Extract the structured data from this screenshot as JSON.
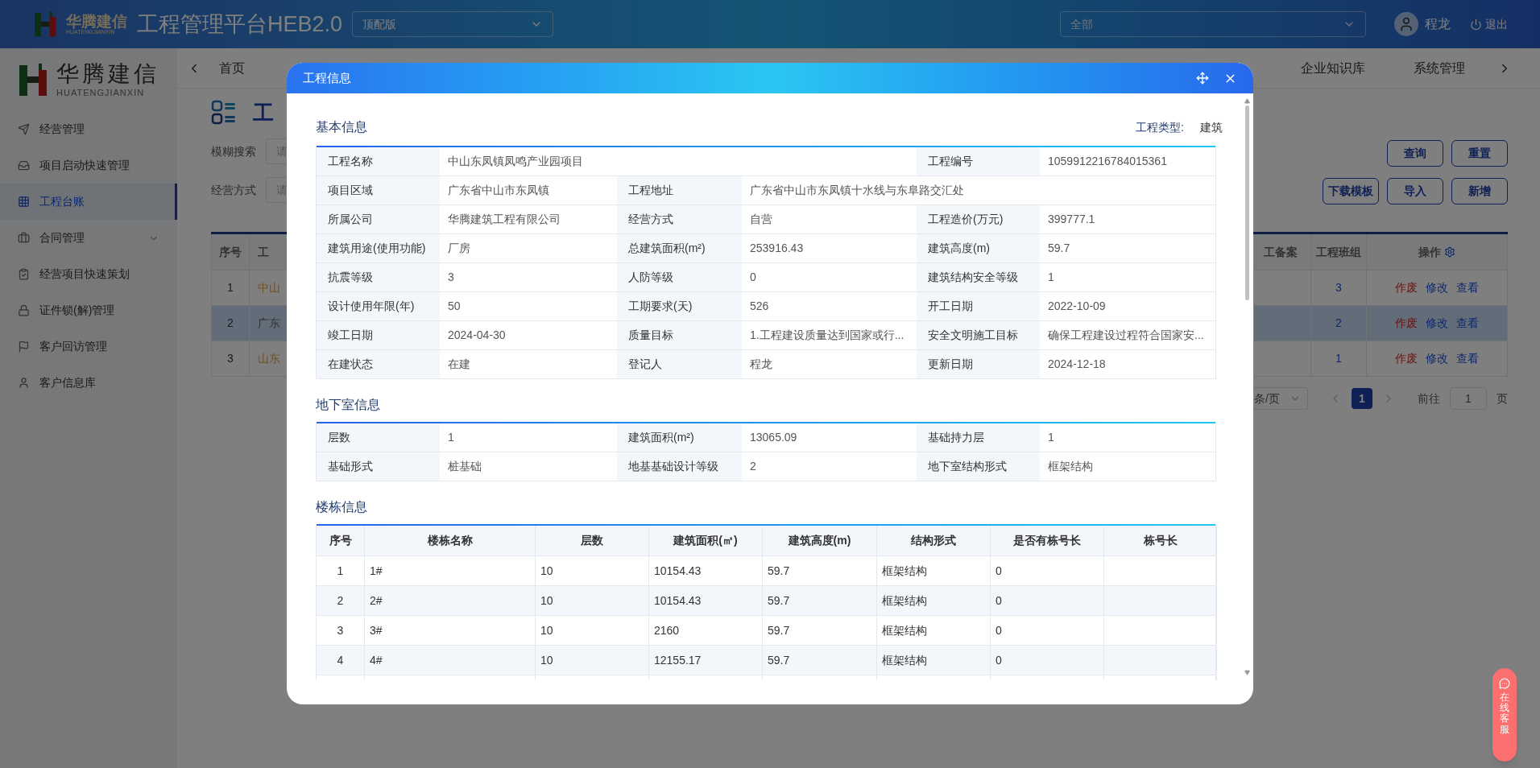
{
  "header": {
    "logo": {
      "name": "华腾建信",
      "subtitle": "HUATENGJIANXIN"
    },
    "title": "工程管理平台HEB2.0",
    "edition_select": {
      "value": "顶配版"
    },
    "scope_select": {
      "value": "全部"
    },
    "user": "程龙",
    "logout": "退出"
  },
  "sidebar": {
    "logo": {
      "name": "华腾建信",
      "subtitle": "HUATENGJIANXIN"
    },
    "items": [
      {
        "label": "经营管理",
        "selected": false,
        "has_submenu": false
      },
      {
        "label": "项目启动快速管理",
        "selected": false,
        "has_submenu": false
      },
      {
        "label": "工程台账",
        "selected": true,
        "has_submenu": false
      },
      {
        "label": "合同管理",
        "selected": false,
        "has_submenu": true
      },
      {
        "label": "经营项目快速策划",
        "selected": false,
        "has_submenu": false
      },
      {
        "label": "证件锁(解)管理",
        "selected": false,
        "has_submenu": false
      },
      {
        "label": "客户回访管理",
        "selected": false,
        "has_submenu": false
      },
      {
        "label": "客户信息库",
        "selected": false,
        "has_submenu": false
      }
    ]
  },
  "nav_tabs": {
    "left": [
      "首页"
    ],
    "right": [
      "企业知识库",
      "系统管理"
    ]
  },
  "page": {
    "title": "工",
    "filters": [
      {
        "label": "模糊搜索",
        "placeholder": "请"
      },
      {
        "label": "经营方式",
        "placeholder": "请"
      }
    ],
    "button_rows": [
      [
        "查询",
        "重置"
      ],
      [
        "下载模板",
        "导入",
        "新增"
      ]
    ],
    "table": {
      "columns_left": [
        "序号",
        "工"
      ],
      "columns_right": [
        "工备案",
        "工程班组",
        "操作"
      ],
      "rows": [
        {
          "index": "1",
          "name": "中山",
          "kind": "warning",
          "team": "3",
          "highlighted": false,
          "actions": [
            {
              "label": "作废",
              "kind": "danger"
            },
            {
              "label": "修改",
              "kind": "normal"
            },
            {
              "label": "查看",
              "kind": "normal"
            }
          ]
        },
        {
          "index": "2",
          "name": "广东",
          "kind": "normal",
          "team": "2",
          "highlighted": true,
          "actions": [
            {
              "label": "作废",
              "kind": "danger"
            },
            {
              "label": "修改",
              "kind": "normal"
            },
            {
              "label": "查看",
              "kind": "normal"
            }
          ]
        },
        {
          "index": "3",
          "name": "山东",
          "kind": "warning",
          "team": "1",
          "highlighted": false,
          "actions": [
            {
              "label": "作废",
              "kind": "danger"
            },
            {
              "label": "修改",
              "kind": "normal"
            },
            {
              "label": "查看",
              "kind": "normal"
            }
          ]
        }
      ]
    },
    "pagination": {
      "page_size": "条/页",
      "pages": [
        {
          "label": "1",
          "selected": true
        }
      ],
      "goto_label": "前往",
      "goto_value": "1",
      "page_suffix": "页"
    }
  },
  "modal": {
    "title": "工程信息",
    "basic": {
      "title": "基本信息",
      "type_label": "工程类型:",
      "type_value": "建筑",
      "rows": [
        [
          {
            "label": "工程名称",
            "value": "中山东凤镇凤鸣产业园项目",
            "wide": true
          },
          {
            "label": "工程编号",
            "value": "1059912216784015361",
            "wide": false
          }
        ],
        [
          {
            "label": "项目区域",
            "value": "广东省中山市东凤镇",
            "wide": false
          },
          {
            "label": "工程地址",
            "value": "广东省中山市东凤镇十水线与东阜路交汇处",
            "wide": true
          }
        ],
        [
          {
            "label": "所属公司",
            "value": "华腾建筑工程有限公司",
            "wide": false
          },
          {
            "label": "经营方式",
            "value": "自营",
            "wide": false
          },
          {
            "label": "工程造价(万元)",
            "value": "399777.1",
            "wide": false
          }
        ],
        [
          {
            "label": "建筑用途(使用功能)",
            "value": "厂房",
            "wide": false
          },
          {
            "label": "总建筑面积(m²)",
            "value": "253916.43",
            "wide": false
          },
          {
            "label": "建筑高度(m)",
            "value": "59.7",
            "wide": false
          }
        ],
        [
          {
            "label": "抗震等级",
            "value": "3",
            "wide": false
          },
          {
            "label": "人防等级",
            "value": "0",
            "wide": false
          },
          {
            "label": "建筑结构安全等级",
            "value": "1",
            "wide": false
          }
        ],
        [
          {
            "label": "设计使用年限(年)",
            "value": "50",
            "wide": false
          },
          {
            "label": "工期要求(天)",
            "value": "526",
            "wide": false
          },
          {
            "label": "开工日期",
            "value": "2022-10-09",
            "wide": false
          }
        ],
        [
          {
            "label": "竣工日期",
            "value": "2024-04-30",
            "wide": false
          },
          {
            "label": "质量目标",
            "value": "1.工程建设质量达到国家或行...",
            "wide": false
          },
          {
            "label": "安全文明施工目标",
            "value": "确保工程建设过程符合国家安...",
            "wide": false
          }
        ],
        [
          {
            "label": "在建状态",
            "value": "在建",
            "wide": false
          },
          {
            "label": "登记人",
            "value": "程龙",
            "wide": false
          },
          {
            "label": "更新日期",
            "value": "2024-12-18",
            "wide": false
          }
        ]
      ]
    },
    "basement": {
      "title": "地下室信息",
      "rows": [
        [
          {
            "label": "层数",
            "value": "1"
          },
          {
            "label": "建筑面积(m²)",
            "value": "13065.09"
          },
          {
            "label": "基础持力层",
            "value": "1"
          }
        ],
        [
          {
            "label": "基础形式",
            "value": "桩基础"
          },
          {
            "label": "地基基础设计等级",
            "value": "2"
          },
          {
            "label": "地下室结构形式",
            "value": "框架结构"
          }
        ]
      ]
    },
    "buildings": {
      "title": "楼栋信息",
      "columns": [
        "序号",
        "楼栋名称",
        "层数",
        "建筑面积(㎡)",
        "建筑高度(m)",
        "结构形式",
        "是否有栋号长",
        "栋号长"
      ],
      "rows": [
        [
          "1",
          "1#",
          "10",
          "10154.43",
          "59.7",
          "框架结构",
          "0",
          ""
        ],
        [
          "2",
          "2#",
          "10",
          "10154.43",
          "59.7",
          "框架结构",
          "0",
          ""
        ],
        [
          "3",
          "3#",
          "10",
          "2160",
          "59.7",
          "框架结构",
          "0",
          ""
        ],
        [
          "4",
          "4#",
          "10",
          "12155.17",
          "59.7",
          "框架结构",
          "0",
          ""
        ]
      ]
    }
  },
  "chat_widget": {
    "label": "在线客服"
  }
}
